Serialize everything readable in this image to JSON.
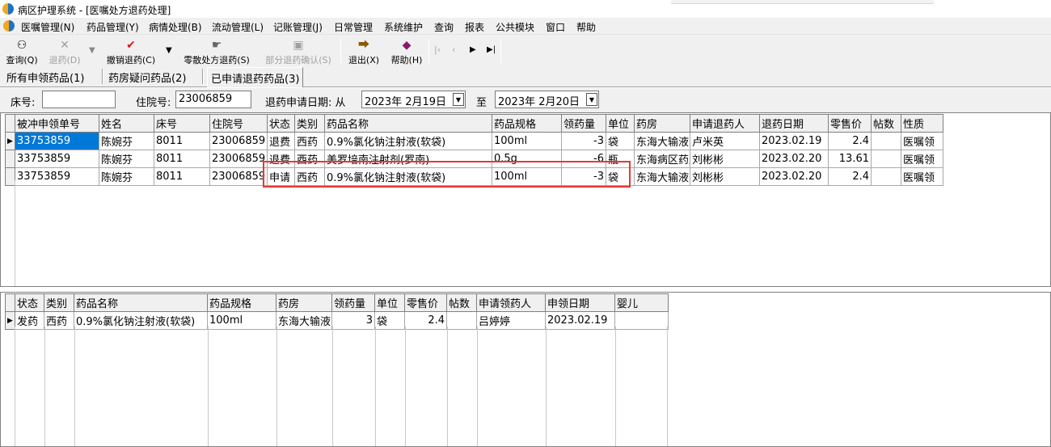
{
  "window": {
    "title": "病区护理系统 - [医嘱处方退药处理]"
  },
  "menu": [
    "医嘱管理(N)",
    "药品管理(Y)",
    "病情处理(B)",
    "流动管理(L)",
    "记账管理(J)",
    "日常管理",
    "系统维护",
    "查询",
    "报表",
    "公共模块",
    "窗口",
    "帮助"
  ],
  "toolbar": {
    "query": "查询(Q)",
    "return": "退药(D)",
    "cancel_return": "撤销退药(C)",
    "bulk_return": "零散处方退药(S)",
    "partial_confirm": "部分退药确认(S)",
    "exit": "退出(X)",
    "help": "帮助(H)"
  },
  "tabs": [
    "所有申领药品(1)",
    "药房疑问药品(2)",
    "已申请退药药品(3)"
  ],
  "filters": {
    "bed_label": "床号:",
    "bed_value": "",
    "admission_label": "住院号:",
    "admission_value": "23006859",
    "date_label": "退药申请日期: 从",
    "date_from": "2023年  2月19日",
    "to_label": "至",
    "date_to": "2023年  2月20日"
  },
  "top_grid": {
    "columns": [
      "被冲申领单号",
      "姓名",
      "床号",
      "住院号",
      "状态",
      "类别",
      "药品名称",
      "药品规格",
      "领药量",
      "单位",
      "药房",
      "申请退药人",
      "退药日期",
      "零售价",
      "帖数",
      "性质"
    ],
    "rows": [
      [
        "33753859",
        "陈婉芬",
        "8011",
        "23006859",
        "退费",
        "西药",
        "0.9%氯化钠注射液(软袋)",
        "100ml",
        "-3",
        "袋",
        "东海大输液",
        "卢米英",
        "2023.02.19",
        "2.4",
        "",
        "医嘱领"
      ],
      [
        "33753859",
        "陈婉芬",
        "8011",
        "23006859",
        "退费",
        "西药",
        "美罗培南注射剂(罗南)",
        "0.5g",
        "-6",
        "瓶",
        "东海病区药房",
        "刘彬彬",
        "2023.02.20",
        "13.61",
        "",
        "医嘱领"
      ],
      [
        "33753859",
        "陈婉芬",
        "8011",
        "23006859",
        "申请",
        "西药",
        "0.9%氯化钠注射液(软袋)",
        "100ml",
        "-3",
        "袋",
        "东海大输液",
        "刘彬彬",
        "2023.02.20",
        "2.4",
        "",
        "医嘱领"
      ]
    ]
  },
  "bottom_grid": {
    "columns": [
      "状态",
      "类别",
      "药品名称",
      "药品规格",
      "药房",
      "领药量",
      "单位",
      "零售价",
      "帖数",
      "申请领药人",
      "申领日期",
      "婴儿"
    ],
    "rows": [
      [
        "发药",
        "西药",
        "0.9%氯化钠注射液(软袋)",
        "100ml",
        "东海大输液",
        "3",
        "袋",
        "2.4",
        "",
        "吕婷婷",
        "2023.02.19",
        ""
      ]
    ]
  }
}
